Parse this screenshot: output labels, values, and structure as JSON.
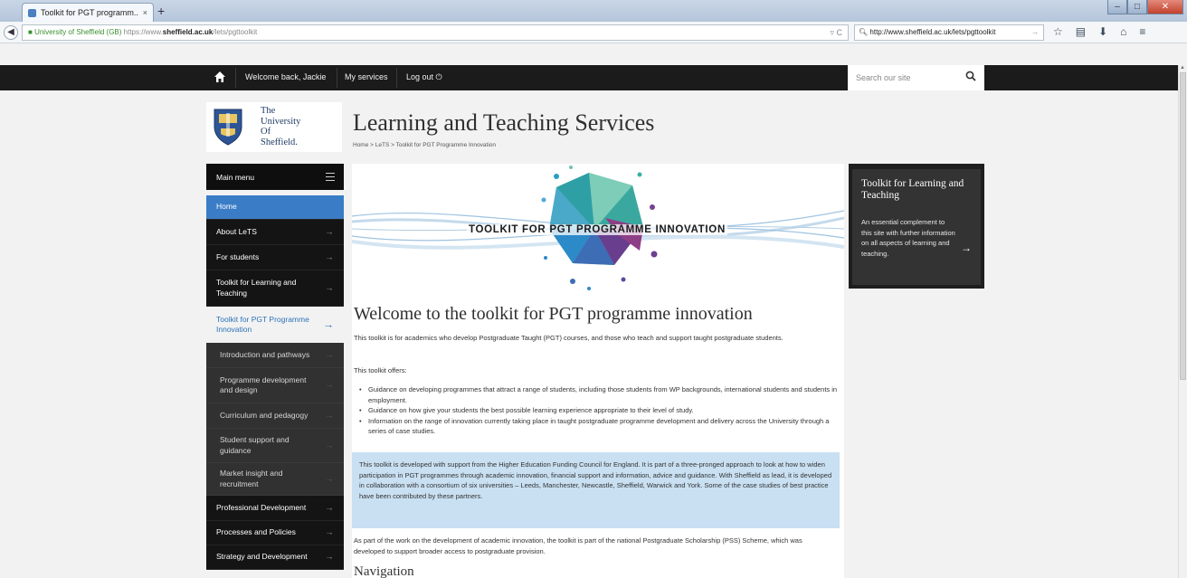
{
  "browser": {
    "tab_title": "Toolkit for PGT programm...",
    "tab_close": "×",
    "new_tab": "+",
    "url": {
      "org": "University of Sheffield (GB)",
      "protocol": "https://www.",
      "domain": "sheffield.ac.uk",
      "path": "/lets/pgttoolkit"
    },
    "search_value": "http://www.sheffield.ac.uk/lets/pgttoolkit",
    "icons": [
      "back-icon",
      "lock-icon",
      "reload-icon",
      "star-icon",
      "bookmarks-icon",
      "download-icon",
      "home-icon",
      "menu-icon"
    ]
  },
  "sitebar": {
    "welcome": "Welcome back, Jackie",
    "my_services": "My services",
    "logout": "Log out",
    "search_placeholder": "Search our site"
  },
  "logo": {
    "line1": "The",
    "line2": "University",
    "line3": "Of",
    "line4": "Sheffield."
  },
  "header": {
    "title": "Learning and Teaching Services",
    "breadcrumb": "Home > LeTS > Toolkit for PGT Programme Innovation"
  },
  "leftnav": {
    "heading": "Main menu",
    "items": [
      {
        "label": "Home"
      },
      {
        "label": "About LeTS"
      },
      {
        "label": "For students"
      },
      {
        "label": "Toolkit for Learning and Teaching"
      },
      {
        "label": "Toolkit for PGT Programme Innovation"
      },
      {
        "label": "Introduction and pathways"
      },
      {
        "label": "Programme development and design"
      },
      {
        "label": "Curriculum and pedagogy"
      },
      {
        "label": "Student support and guidance"
      },
      {
        "label": "Market insight and recruitment"
      },
      {
        "label": "Professional Development"
      },
      {
        "label": "Processes and Policies"
      },
      {
        "label": "Strategy and Development"
      }
    ]
  },
  "main": {
    "banner_text": "TOOLKIT FOR PGT PROGRAMME INNOVATION",
    "heading": "Welcome to the toolkit for PGT programme innovation",
    "intro": "This toolkit is for academics who develop Postgraduate Taught (PGT) courses, and those who teach and support taught postgraduate students.",
    "offers_label": "This toolkit offers:",
    "bullets": [
      "Guidance on developing programmes that attract a range of students, including those students from WP backgrounds, international students and students in employment.",
      "Guidance on how give your students the best possible learning experience appropriate to their level of study.",
      "Information on the range of innovation currently taking place in taught postgraduate programme development and delivery across the University through a series of case studies."
    ],
    "callout": "This toolkit is developed with support from the Higher Education Funding Council for England. It is part of a three-pronged approach to look at how to widen participation in PGT programmes through academic innovation, financial support and information, advice and guidance. With Sheffield as lead, it is developed in collaboration with a consortium of six universities – Leeds, Manchester, Newcastle, Sheffield, Warwick and York. Some of the case studies of best practice have been contributed by these partners.",
    "para_pss": "As part of the work on the development of academic innovation, the toolkit is part of the national Postgraduate Scholarship (PSS) Scheme, which was developed to support broader access to postgraduate provision.",
    "nav_heading": "Navigation"
  },
  "aside": {
    "title": "Toolkit for Learning and Teaching",
    "desc": "An essential complement to this site with further information on all aspects of learning and teaching."
  },
  "colors": {
    "accent_blue": "#3a7dc6",
    "callout_bg": "#c9e0f2",
    "nav_black": "#141414"
  }
}
